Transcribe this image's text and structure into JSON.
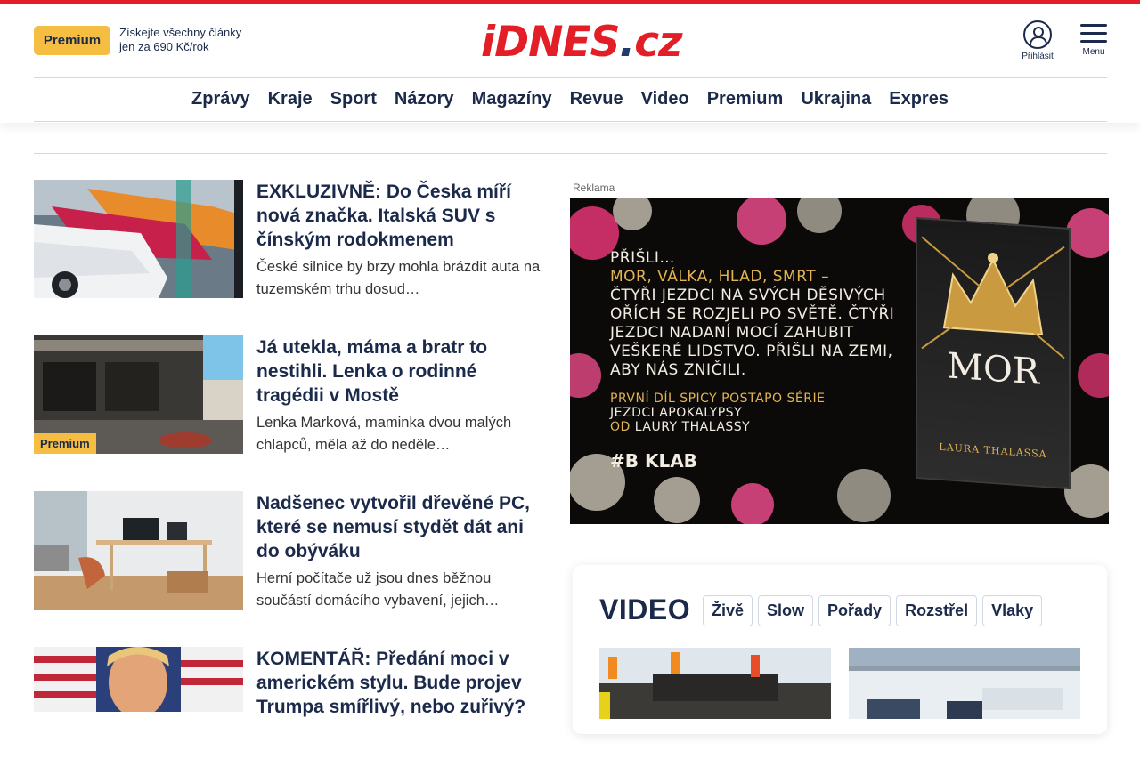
{
  "header": {
    "premium_label": "Premium",
    "promo_line1": "Získejte všechny články",
    "promo_line2": "jen za 690 Kč/rok",
    "logo_main": "iDNES",
    "logo_dot": ".",
    "logo_tld": "cz",
    "login_label": "Přihlásit",
    "menu_label": "Menu"
  },
  "nav": {
    "items": [
      "Zprávy",
      "Kraje",
      "Sport",
      "Názory",
      "Magazíny",
      "Revue",
      "Video",
      "Premium",
      "Ukrajina",
      "Expres"
    ]
  },
  "articles": [
    {
      "title": "EXKLUZIVNĚ: Do Česka míří nová značka. Italská SUV s čínským rodokmenem",
      "perex": "České silnice by brzy mohla brázdit auta na tuzemském trhu dosud…"
    },
    {
      "title": "Já utekla, máma a bratr to nestihli. Lenka o rodinné tragédii v Mostě",
      "perex": "Lenka Marková, maminka dvou malých chlapců, měla až do neděle…",
      "badge": "Premium"
    },
    {
      "title": "Nadšenec vytvořil dřevěné PC, které se nemusí stydět dát ani do obýváku",
      "perex": "Herní počítače už jsou dnes běžnou součástí domácího vybavení, jejich…"
    },
    {
      "title": "KOMENTÁŘ: Předání moci v americkém stylu. Bude projev Trumpa smířlivý, nebo zuřivý?",
      "perex": ""
    }
  ],
  "ad": {
    "label": "Reklama",
    "line1": "PŘIŠLI…",
    "line2": "MOR, VÁLKA, HLAD, SMRT –",
    "line3": "ČTYŘI JEZDCI NA SVÝCH DĚSIVÝCH OŘÍCH SE ROZJELI PO SVĚTĚ. ČTYŘI JEZDCI NADANÍ MOCÍ ZAHUBIT VEŠKERÉ LIDSTVO. PŘIŠLI NA ZEMI, ABY NÁS ZNIČILI.",
    "sub1": "PRVNÍ DÍL SPICY POSTAPO SÉRIE",
    "sub2": "JEZDCI APOKALYPSY",
    "sub3_prefix": "OD",
    "sub3_name": "LAURY THALASSY",
    "tag": "#B  KLAB",
    "book_title": "MOR",
    "book_author": "LAURA THALASSA"
  },
  "video": {
    "title": "VIDEO",
    "tabs": [
      "Živě",
      "Slow",
      "Pořady",
      "Rozstřel",
      "Vlaky"
    ]
  }
}
